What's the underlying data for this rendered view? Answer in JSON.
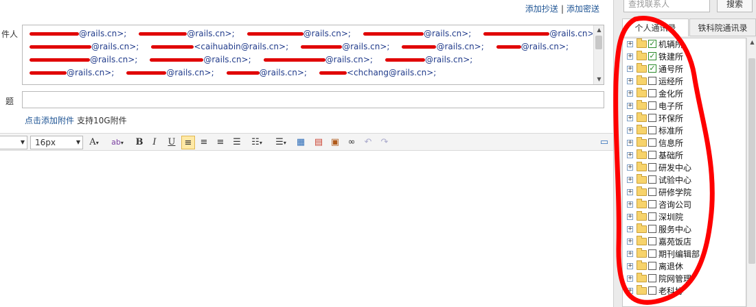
{
  "header": {
    "add_cc": "添加抄送",
    "separator": "|",
    "add_bcc": "添加密送"
  },
  "form": {
    "recipient_label": "件人",
    "subject_label": "题",
    "attach_link": "点击添加附件",
    "attach_note": "支持10G附件"
  },
  "recipients": [
    [
      {
        "addr": "@rails.cn>;"
      },
      {
        "addr": "@rails.cn>;"
      },
      {
        "addr": "@rails.cn>;"
      },
      {
        "addr": "@rails.cn>;"
      },
      {
        "addr": "@rails.cn>;"
      }
    ],
    [
      {
        "addr": "@rails.cn>;"
      },
      {
        "addr": "<caihuabin@rails.cn>;"
      },
      {
        "addr": "@rails.cn>;"
      },
      {
        "addr": "@rails.cn>;"
      },
      {
        "addr": "@rails.cn>;"
      }
    ],
    [
      {
        "addr": "@rails.cn>;"
      },
      {
        "addr": "@rails.cn>;"
      },
      {
        "addr": "@rails.cn>;"
      },
      {
        "addr": "@rails.cn>;"
      }
    ],
    [
      {
        "addr": "@rails.cn>;"
      },
      {
        "addr": "@rails.cn>;"
      },
      {
        "addr": "@rails.cn>;"
      },
      {
        "addr": "<chchang@rails.cn>;"
      }
    ]
  ],
  "toolbar": {
    "font_size": "16px",
    "bold": "B",
    "italic": "I",
    "underline": "U"
  },
  "sidebar": {
    "search_placeholder": "查找联系人",
    "search_button": "搜索",
    "tab_personal": "个人通讯录",
    "tab_institute": "铁科院通讯录",
    "tree": [
      {
        "label": "机辆所",
        "checked": true
      },
      {
        "label": "铁建所",
        "checked": true
      },
      {
        "label": "通号所",
        "checked": true
      },
      {
        "label": "运经所",
        "checked": false
      },
      {
        "label": "金化所",
        "checked": false
      },
      {
        "label": "电子所",
        "checked": false
      },
      {
        "label": "环保所",
        "checked": false
      },
      {
        "label": "标准所",
        "checked": false
      },
      {
        "label": "信息所",
        "checked": false
      },
      {
        "label": "基础所",
        "checked": false
      },
      {
        "label": "研发中心",
        "checked": false
      },
      {
        "label": "试验中心",
        "checked": false
      },
      {
        "label": "研修学院",
        "checked": false
      },
      {
        "label": "咨询公司",
        "checked": false
      },
      {
        "label": "深圳院",
        "checked": false
      },
      {
        "label": "服务中心",
        "checked": false
      },
      {
        "label": "嘉苑饭店",
        "checked": false
      },
      {
        "label": "期刊编辑部",
        "checked": false
      },
      {
        "label": "离退休",
        "checked": false
      },
      {
        "label": "院网管理",
        "checked": false
      },
      {
        "label": "老科协",
        "checked": false
      }
    ]
  },
  "colors": {
    "link": "#1e5494",
    "redaction": "#e00000",
    "checkmark": "#2a8a2a"
  }
}
